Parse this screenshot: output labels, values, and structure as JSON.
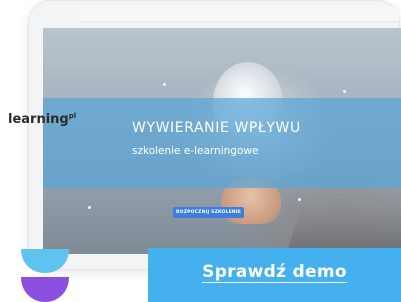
{
  "promo": {
    "brand": "learning",
    "brand_mark": "pl",
    "course_title": "WYWIERANIE WPŁYWU",
    "course_subtitle": "szkolenie e-learningowe",
    "start_button": "ROZPOCZNIJ SZKOLENIE",
    "demo_button": "Sprawdź demo"
  },
  "icons": [
    "cloud-logo-shape-icon"
  ],
  "colors": {
    "band": "#5aa5d7",
    "cta": "#45b0ee",
    "start_button": "#3f7ee0",
    "logo_top": "#5fc3f0",
    "logo_bottom": "#8b4fe0"
  }
}
